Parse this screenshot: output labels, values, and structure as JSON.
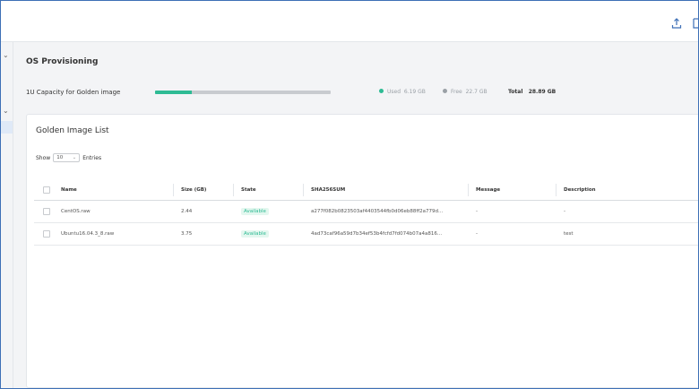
{
  "page": {
    "title": "OS Provisioning"
  },
  "capacity": {
    "label": "1U Capacity for Golden image",
    "used_fraction": 0.21,
    "used_label": "Used",
    "used_value": "6.19 GB",
    "free_label": "Free",
    "free_value": "22.7 GB",
    "total_label": "Total",
    "total_value": "28.89 GB",
    "colors": {
      "used": "#2ebb94",
      "free": "#c8cbcf"
    }
  },
  "card": {
    "title": "Golden Image List",
    "show_label": "Show",
    "page_size": "10",
    "entries_label": "Entries"
  },
  "table": {
    "columns": [
      "Name",
      "Size (GB)",
      "State",
      "SHA256SUM",
      "Message",
      "Description"
    ],
    "rows": [
      {
        "name": "CentOS.raw",
        "size": "2.44",
        "state": "Available",
        "sha": "a277f082b0823503af4403544fb0d06eb88ff2a779d...",
        "message": "-",
        "description": "-"
      },
      {
        "name": "Ubuntu16.04.3_8.raw",
        "size": "3.75",
        "state": "Available",
        "sha": "4ad73caf96a59d7b34ef53b4fcfd7fd074b07a4a816...",
        "message": "-",
        "description": "test"
      }
    ]
  },
  "icons": {
    "top_upload": "upload-icon",
    "top_export": "export-icon"
  }
}
